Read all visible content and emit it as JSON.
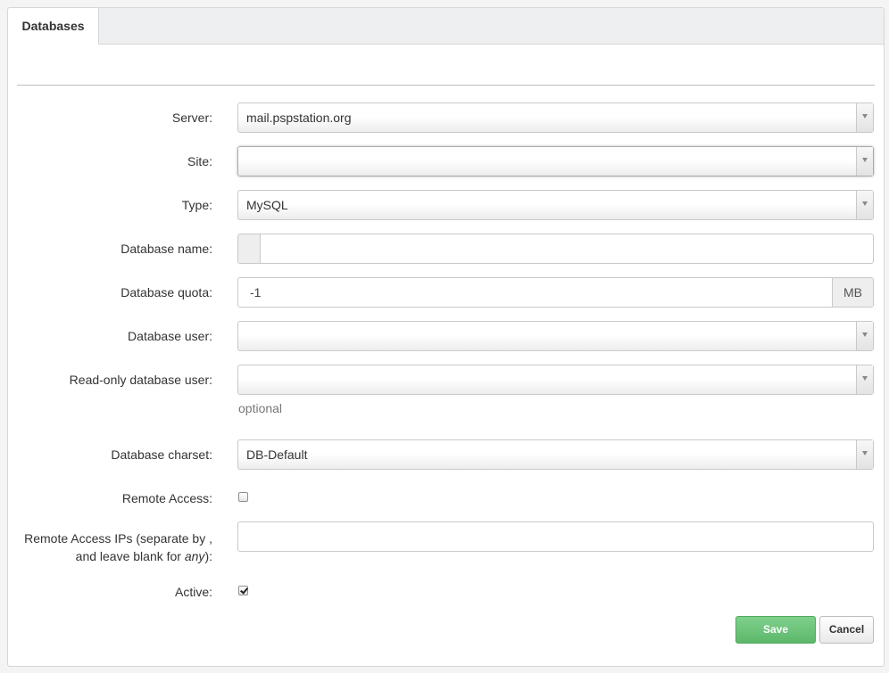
{
  "tabs": [
    {
      "label": "Databases",
      "active": true
    }
  ],
  "form": {
    "server": {
      "label": "Server:",
      "value": "mail.pspstation.org"
    },
    "site": {
      "label": "Site:",
      "value": ""
    },
    "type": {
      "label": "Type:",
      "value": "MySQL"
    },
    "database_name": {
      "label": "Database name:",
      "value": ""
    },
    "database_quota": {
      "label": "Database quota:",
      "value": "-1",
      "unit": "MB"
    },
    "database_user": {
      "label": "Database user:",
      "value": ""
    },
    "readonly_user": {
      "label": "Read-only database user:",
      "value": "",
      "help": "optional"
    },
    "charset": {
      "label": "Database charset:",
      "value": "DB-Default"
    },
    "remote_access": {
      "label": "Remote Access:",
      "checked": false
    },
    "remote_ips": {
      "label_line1": "Remote Access IPs (separate by ,",
      "label_line2_prefix": "and leave blank for ",
      "label_line2_em": "any",
      "label_line2_suffix": "):",
      "value": ""
    },
    "active": {
      "label": "Active:",
      "checked": true
    }
  },
  "buttons": {
    "save": "Save",
    "cancel": "Cancel"
  },
  "colors": {
    "save_button": "#5cb86a",
    "panel_bg": "#ffffff",
    "page_bg": "#f4f4f4"
  }
}
